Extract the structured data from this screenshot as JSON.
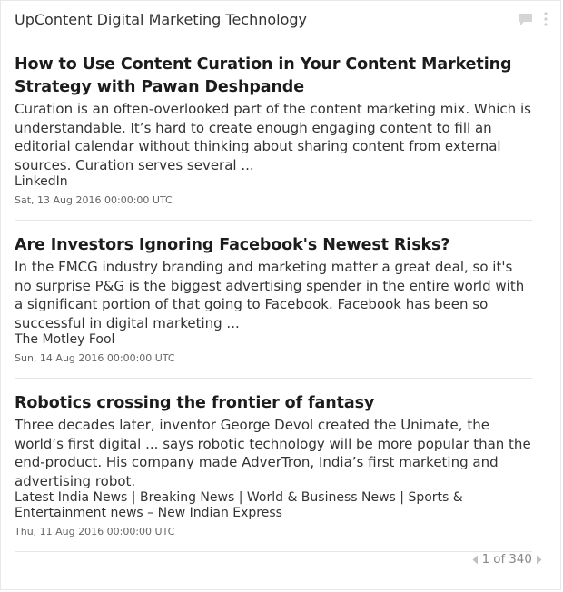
{
  "widget": {
    "title": "UpContent Digital Marketing Technology",
    "icons": [
      "comment-icon",
      "more-vertical-icon"
    ]
  },
  "articles": [
    {
      "title": "How to Use Content Curation in Your Content Marketing Strategy with Pawan Deshpande",
      "snippet": "Curation is an often-overlooked part of the content marketing mix. Which is understandable. It’s hard to create enough engaging content to fill an editorial calendar without thinking about sharing content from external sources. Curation serves several ...",
      "source": "LinkedIn",
      "date": "Sat, 13 Aug 2016 00:00:00 UTC"
    },
    {
      "title": "Are Investors Ignoring Facebook's Newest Risks?",
      "snippet": "In the FMCG industry branding and marketing matter a great deal, so it's no surprise P&G is the biggest advertising spender in the entire world with a significant portion of that going to Facebook. Facebook has been so successful in digital marketing ...",
      "source": "The Motley Fool",
      "date": "Sun, 14 Aug 2016 00:00:00 UTC"
    },
    {
      "title": "Robotics crossing the frontier of fantasy",
      "snippet": "Three decades later, inventor George Devol created the Unimate, the world’s first digital ... says robotic technology will be more popular than the end-product. His company made AdverTron, India’s first marketing and advertising robot.",
      "source": "Latest India News | Breaking News | World & Business News | Sports & Entertainment news – New Indian Express",
      "date": "Thu, 11 Aug 2016 00:00:00 UTC"
    }
  ],
  "pager": {
    "current": "1",
    "of_label": "of",
    "total": "340"
  }
}
